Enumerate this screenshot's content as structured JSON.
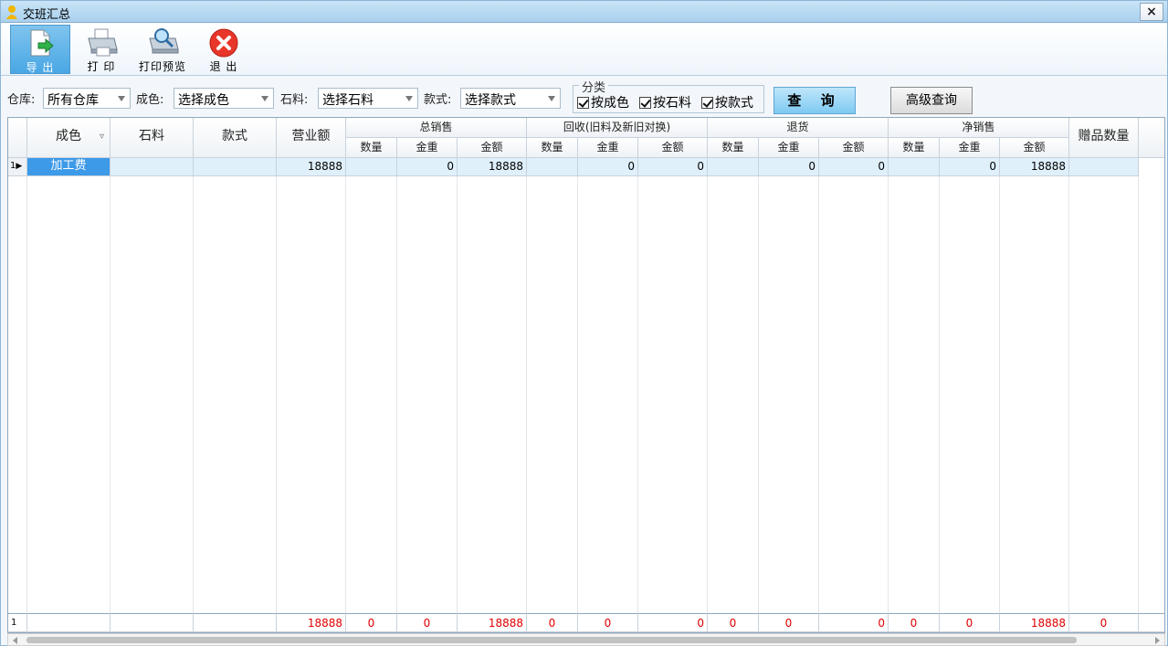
{
  "window": {
    "title": "交班汇总",
    "close_label": "×"
  },
  "toolbar": {
    "export_label": "导 出",
    "print_label": "打 印",
    "preview_label": "打印预览",
    "exit_label": "退 出"
  },
  "filters": {
    "warehouse_label": "仓库:",
    "warehouse_value": "所有仓库",
    "color_label": "成色:",
    "color_value": "选择成色",
    "stone_label": "石料:",
    "stone_value": "选择石料",
    "style_label": "款式:",
    "style_value": "选择款式",
    "group_title": "分类",
    "by_color": "按成色",
    "by_stone": "按石料",
    "by_style": "按款式",
    "query_label": "查 询",
    "advanced_label": "高级查询"
  },
  "table": {
    "headers": {
      "color": "成色",
      "stone": "石料",
      "style": "款式",
      "revenue": "营业额",
      "total_sales": "总销售",
      "recycle": "回收(旧料及新旧对换)",
      "returns": "退货",
      "net_sales": "净销售",
      "gift_qty": "赠品数量",
      "qty": "数量",
      "gold_weight": "金重",
      "amount": "金额"
    },
    "row": {
      "index": "1",
      "color": "加工费",
      "revenue": "18888",
      "ts_weight": "0",
      "ts_amount": "18888",
      "rc_weight": "0",
      "rc_amount": "0",
      "rt_weight": "0",
      "rt_amount": "0",
      "ns_weight": "0",
      "ns_amount": "18888"
    },
    "footer": {
      "index": "1",
      "revenue": "18888",
      "ts_qty": "0",
      "ts_weight": "0",
      "ts_amount": "18888",
      "rc_qty": "0",
      "rc_weight": "0",
      "rc_amount": "0",
      "rt_qty": "0",
      "rt_weight": "0",
      "rt_amount": "0",
      "ns_qty": "0",
      "ns_weight": "0",
      "ns_amount": "18888",
      "gift_qty": "0"
    }
  },
  "colors": {
    "accent": "#49a7e4",
    "selected_row": "#dff0fb",
    "selected_cell": "#3d9ae8",
    "footer_text": "#e00000"
  }
}
